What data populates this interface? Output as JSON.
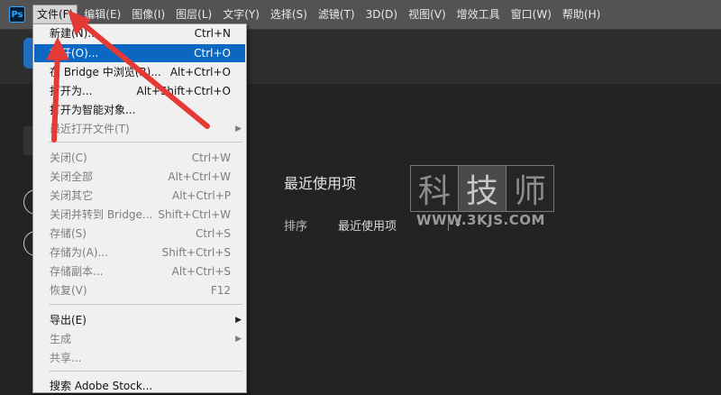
{
  "app": {
    "logo_text": "Ps"
  },
  "menubar": {
    "items": [
      "文件(F)",
      "编辑(E)",
      "图像(I)",
      "图层(L)",
      "文字(Y)",
      "选择(S)",
      "滤镜(T)",
      "3D(D)",
      "视图(V)",
      "增效工具",
      "窗口(W)",
      "帮助(H)"
    ],
    "active_index": 0
  },
  "file_menu": {
    "items": [
      {
        "label": "新建(N)...",
        "shortcut": "Ctrl+N",
        "disabled": false
      },
      {
        "label": "打开(O)...",
        "shortcut": "Ctrl+O",
        "disabled": false,
        "highlighted": true
      },
      {
        "label": "在 Bridge 中浏览(B)...",
        "shortcut": "Alt+Ctrl+O",
        "disabled": false
      },
      {
        "label": "打开为...",
        "shortcut": "Alt+Shift+Ctrl+O",
        "disabled": false
      },
      {
        "label": "打开为智能对象...",
        "shortcut": "",
        "disabled": false
      },
      {
        "label": "最近打开文件(T)",
        "shortcut": "",
        "disabled": true,
        "submenu": true
      },
      {
        "label": "关闭(C)",
        "shortcut": "Ctrl+W",
        "disabled": true
      },
      {
        "label": "关闭全部",
        "shortcut": "Alt+Ctrl+W",
        "disabled": true
      },
      {
        "label": "关闭其它",
        "shortcut": "Alt+Ctrl+P",
        "disabled": true
      },
      {
        "label": "关闭并转到 Bridge...",
        "shortcut": "Shift+Ctrl+W",
        "disabled": true
      },
      {
        "label": "存储(S)",
        "shortcut": "Ctrl+S",
        "disabled": true
      },
      {
        "label": "存储为(A)...",
        "shortcut": "Shift+Ctrl+S",
        "disabled": true
      },
      {
        "label": "存储副本...",
        "shortcut": "Alt+Ctrl+S",
        "disabled": true
      },
      {
        "label": "恢复(V)",
        "shortcut": "F12",
        "disabled": true
      },
      {
        "label": "导出(E)",
        "shortcut": "",
        "disabled": false,
        "submenu": true
      },
      {
        "label": "生成",
        "shortcut": "",
        "disabled": true,
        "submenu": true
      },
      {
        "label": "共享...",
        "shortcut": "",
        "disabled": true
      },
      {
        "label": "搜索 Adobe Stock...",
        "shortcut": "",
        "disabled": false
      }
    ]
  },
  "home": {
    "recent_title": "最近使用项",
    "sort_label": "排序",
    "sort_value": "最近使用项"
  },
  "watermark": {
    "chars": [
      "科",
      "技",
      "师"
    ],
    "url": "WWW.3KJS.COM"
  },
  "colors": {
    "highlight": "#0b67c2",
    "annotation_arrow": "#e53935"
  }
}
